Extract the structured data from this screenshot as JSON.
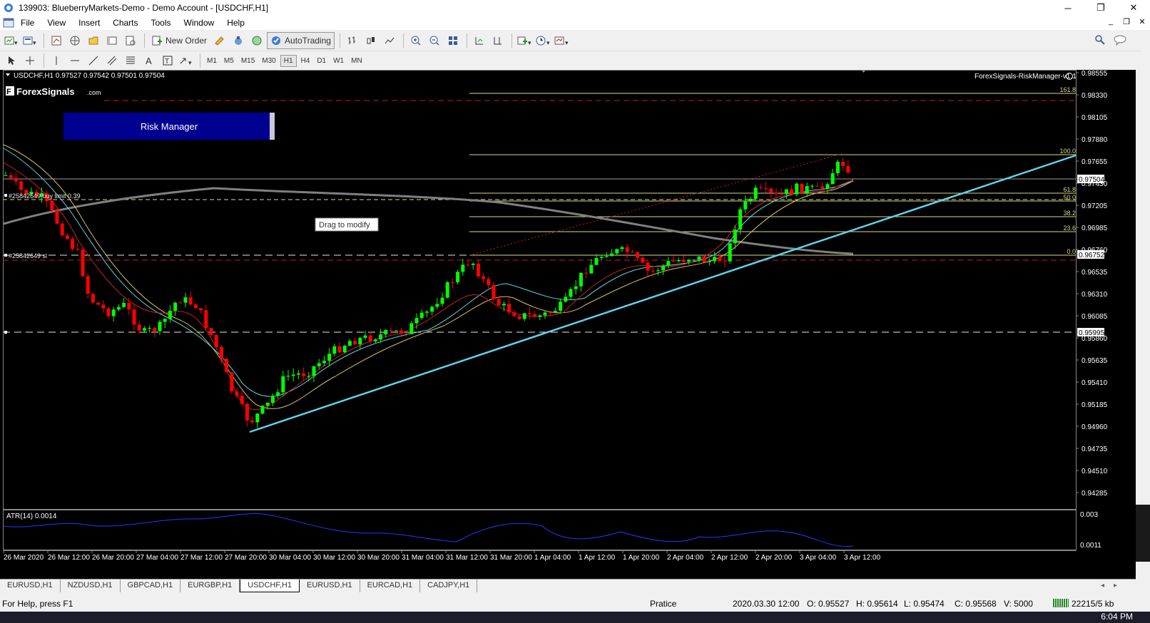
{
  "window": {
    "title": "139903: BlueberryMarkets-Demo - Demo Account - [USDCHF,H1]",
    "minimize": "─",
    "restore": "❐",
    "close": "✕"
  },
  "menu": [
    "File",
    "View",
    "Insert",
    "Charts",
    "Tools",
    "Window",
    "Help"
  ],
  "toolbar": {
    "new_order": "New Order",
    "autotrading": "AutoTrading"
  },
  "timeframes": [
    "M1",
    "M5",
    "M15",
    "M30",
    "H1",
    "H4",
    "D1",
    "W1",
    "MN"
  ],
  "active_timeframe": "H1",
  "chart": {
    "info_line": "USDCHF,H1  0.97527 0.97542 0.97501 0.97504",
    "brand_name": "ForexSignals",
    "brand_suffix": ".com",
    "ea_label": "ForexSignals-RiskManager-v1.1",
    "risk_manager_button": "Risk Manager",
    "tooltip": "Drag to modify",
    "order_label": "#25842649 buy limit 0.39",
    "sl_label": "#25842649 sl",
    "fib_levels": [
      {
        "label": "161.8"
      },
      {
        "label": "100.0"
      },
      {
        "label": "61.8"
      },
      {
        "label": "50.0"
      },
      {
        "label": "38.2"
      },
      {
        "label": "23.6"
      },
      {
        "label": "0.0"
      }
    ],
    "price_ticks": [
      "0.98555",
      "0.98330",
      "0.98105",
      "0.97880",
      "0.97655",
      "0.97430",
      "0.97205",
      "0.96985",
      "0.96760",
      "0.96535",
      "0.96310",
      "0.96085",
      "0.95860",
      "0.95635",
      "0.95410",
      "0.95185",
      "0.94960",
      "0.94735",
      "0.94510",
      "0.94285"
    ],
    "price_boxes": {
      "current": "0.97504",
      "fib_zero": "0.96752",
      "line": "0.95995"
    },
    "atr_label": "ATR(14) 0.0014",
    "atr_ticks": [
      "0.003",
      "0.0011"
    ],
    "time_ticks": [
      "26 Mar 2020",
      "26 Mar 12:00",
      "26 Mar 20:00",
      "27 Mar 04:00",
      "27 Mar 12:00",
      "27 Mar 20:00",
      "30 Mar 04:00",
      "30 Mar 12:00",
      "30 Mar 20:00",
      "31 Mar 04:00",
      "31 Mar 12:00",
      "31 Mar 20:00",
      "1 Apr 04:00",
      "1 Apr 12:00",
      "1 Apr 20:00",
      "2 Apr 04:00",
      "2 Apr 12:00",
      "2 Apr 20:00",
      "3 Apr 04:00",
      "3 Apr 12:00"
    ]
  },
  "tabs": [
    "EURUSD,H1",
    "NZDUSD,H1",
    "GBPCAD,H1",
    "EURGBP,H1",
    "USDCHF,H1",
    "EURUSD,H1",
    "EURCAD,H1",
    "CADJPY,H1"
  ],
  "active_tab": "USDCHF,H1",
  "status": {
    "help": "For Help, press F1",
    "profile": "Pratice",
    "datetime": "2020.03.30 12:00",
    "open": "O: 0.95527",
    "high": "H: 0.95614",
    "low": "L: 0.95474",
    "close": "C: 0.95568",
    "volume": "V: 5000",
    "traffic": "22215/5 kb"
  },
  "taskbar": {
    "clock": "6:04 PM"
  },
  "colors": {
    "bull": "#00ff00",
    "bear": "#ff0000",
    "trendline": "#5fd3e6",
    "fib": "#d8d890",
    "ma_gray": "#808080",
    "atr": "#1e3cff",
    "risk_btn": "#000090"
  }
}
